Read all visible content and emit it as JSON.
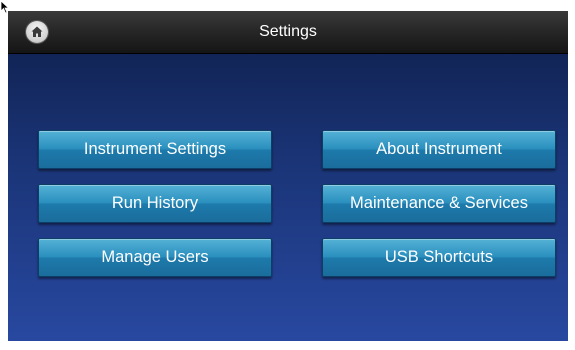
{
  "window": {
    "title": "Settings"
  },
  "menu": {
    "instrument_settings": "Instrument Settings",
    "about_instrument": "About Instrument",
    "run_history": "Run History",
    "maintenance_services": "Maintenance & Services",
    "manage_users": "Manage Users",
    "usb_shortcuts": "USB Shortcuts"
  },
  "colors": {
    "title_bar": "#262626",
    "background_top": "#0e1e4a",
    "background_bottom": "#2848a0",
    "button_fill": "#2a8fbe",
    "button_text": "#ffffff"
  },
  "icons": {
    "home": "home-icon",
    "cursor": "mouse-pointer-icon"
  }
}
